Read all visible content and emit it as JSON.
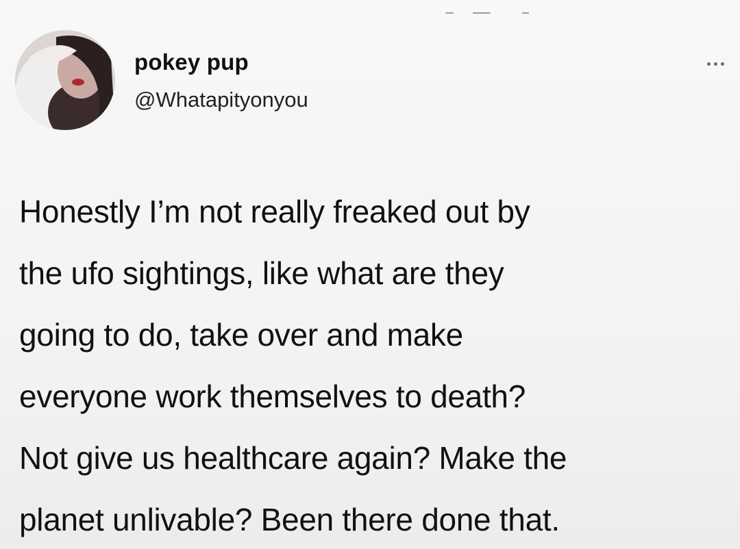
{
  "author": {
    "name": "pokey pup",
    "handle": "@Whatapityonyou",
    "avatar": "profile-photo-icon"
  },
  "menu_icon": "more-options-icon",
  "tweet": {
    "lines": [
      "Honestly I’m not really freaked out by",
      "the ufo sightings, like what are they",
      "going to do, take over and make",
      "everyone work themselves to death?",
      "Not give us healthcare again? Make the",
      "planet unlivable? Been there done that."
    ]
  },
  "colors": {
    "background": "#f7f7f7",
    "text": "#141414"
  }
}
